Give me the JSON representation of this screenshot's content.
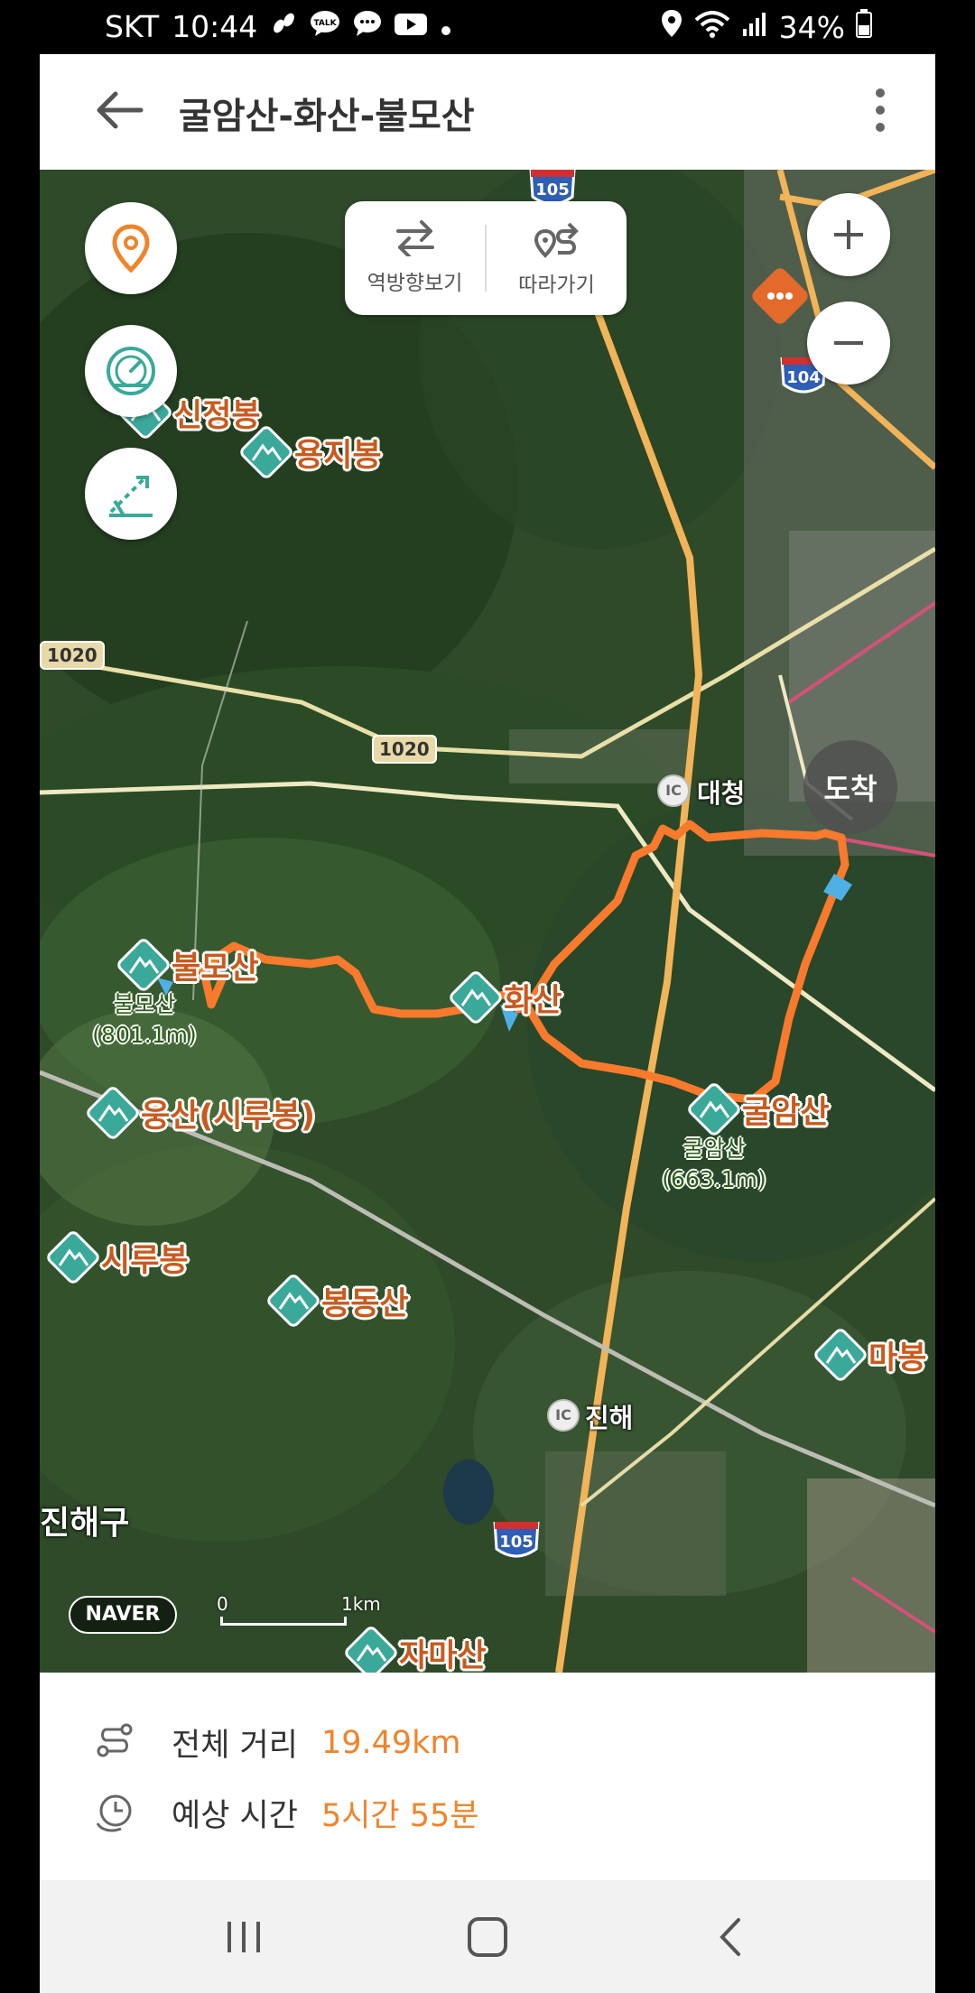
{
  "status_bar": {
    "carrier": "SKT",
    "time": "10:44",
    "battery": "34%",
    "notification_icons": [
      "footsteps-icon",
      "talk-icon",
      "youtube-icon",
      "dot-icon"
    ],
    "system_icons": [
      "location-icon",
      "wifi-icon",
      "signal-icon",
      "battery-icon"
    ]
  },
  "header": {
    "title": "굴암산-화산-불모산"
  },
  "map": {
    "toggle_panel": {
      "reverse_label": "역방향보기",
      "follow_label": "따라가기"
    },
    "arrive_label": "도착",
    "peaks": [
      {
        "name": "신정봉"
      },
      {
        "name": "용지봉"
      },
      {
        "name": "불모산",
        "sub": "불모산\n(801.1m)"
      },
      {
        "name": "화산"
      },
      {
        "name": "굴암산",
        "sub": "굴암산\n(663.1m)"
      },
      {
        "name": "웅산(시루봉)"
      },
      {
        "name": "시루봉"
      },
      {
        "name": "봉동산"
      },
      {
        "name": "마봉"
      },
      {
        "name": "자마산"
      }
    ],
    "places": {
      "daecheong": "대청",
      "jinhae": "진해",
      "jinhae_gu": "진해구"
    },
    "roads": {
      "r1020_a": "1020",
      "r1020_b": "1020",
      "hwy105_top": "105",
      "hwy104": "104",
      "hwy105_bottom": "105",
      "ic": "IC"
    },
    "naver_logo": "NAVER",
    "scale": {
      "zero": "0",
      "one": "1km"
    }
  },
  "info": {
    "distance_label": "전체 거리",
    "distance_value": "19.49km",
    "time_label": "예상 시간",
    "time_value": "5시간 55분"
  },
  "colors": {
    "accent": "#f0842b",
    "route": "#f97a2c",
    "peak_icon": "#3aa99a",
    "peak_label": "#c95a1e"
  }
}
